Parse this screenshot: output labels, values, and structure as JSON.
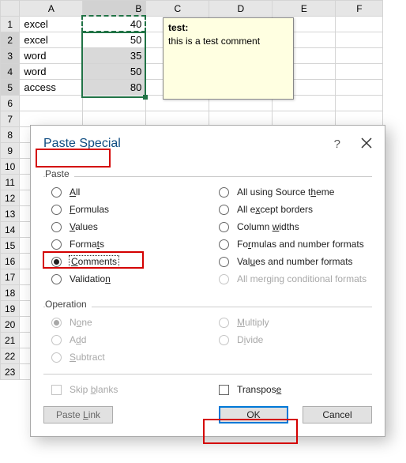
{
  "sheet": {
    "cols": [
      "A",
      "B",
      "C",
      "D",
      "E",
      "F"
    ],
    "rows": [
      {
        "n": "1",
        "a": "excel",
        "b": "40"
      },
      {
        "n": "2",
        "a": "excel",
        "b": "50"
      },
      {
        "n": "3",
        "a": "word",
        "b": "35"
      },
      {
        "n": "4",
        "a": "word",
        "b": "50"
      },
      {
        "n": "5",
        "a": "access",
        "b": "80"
      },
      {
        "n": "6",
        "a": "",
        "b": ""
      },
      {
        "n": "7",
        "a": "",
        "b": ""
      },
      {
        "n": "8",
        "a": "",
        "b": ""
      },
      {
        "n": "9",
        "a": "",
        "b": ""
      },
      {
        "n": "10",
        "a": "",
        "b": ""
      },
      {
        "n": "11",
        "a": "",
        "b": ""
      },
      {
        "n": "12",
        "a": "",
        "b": ""
      },
      {
        "n": "13",
        "a": "",
        "b": ""
      },
      {
        "n": "14",
        "a": "",
        "b": ""
      },
      {
        "n": "15",
        "a": "",
        "b": ""
      },
      {
        "n": "16",
        "a": "",
        "b": ""
      },
      {
        "n": "17",
        "a": "",
        "b": ""
      },
      {
        "n": "18",
        "a": "",
        "b": ""
      },
      {
        "n": "19",
        "a": "",
        "b": ""
      },
      {
        "n": "20",
        "a": "",
        "b": ""
      },
      {
        "n": "21",
        "a": "",
        "b": ""
      },
      {
        "n": "22",
        "a": "",
        "b": ""
      },
      {
        "n": "23",
        "a": "",
        "b": ""
      }
    ]
  },
  "comment": {
    "title": "test:",
    "body": "this is a test comment"
  },
  "dialog": {
    "title": "Paste Special",
    "help": "?",
    "section_paste": "Paste",
    "section_operation": "Operation",
    "paste_opts_left": [
      {
        "label": "All",
        "u": "A"
      },
      {
        "label": "Formulas",
        "u": "F"
      },
      {
        "label": "Values",
        "u": "V"
      },
      {
        "label": "Formats",
        "u": "t"
      },
      {
        "label": "Comments",
        "u": "C"
      },
      {
        "label": "Validation",
        "u": "n"
      }
    ],
    "paste_opts_right": [
      {
        "label": "All using Source theme",
        "u": "h"
      },
      {
        "label": "All except borders",
        "u": "x"
      },
      {
        "label": "Column widths",
        "u": "w"
      },
      {
        "label": "Formulas and number formats",
        "u": "r"
      },
      {
        "label": "Values and number formats",
        "u": "u"
      },
      {
        "label": "All merging conditional formats",
        "u": "g"
      }
    ],
    "op_opts_left": [
      {
        "label": "None",
        "u": "o"
      },
      {
        "label": "Add",
        "u": "d"
      },
      {
        "label": "Subtract",
        "u": "S"
      }
    ],
    "op_opts_right": [
      {
        "label": "Multiply",
        "u": "M"
      },
      {
        "label": "Divide",
        "u": "i"
      }
    ],
    "skip_blanks": "Skip blanks",
    "transpose": "Transpose",
    "paste_link": "Paste Link",
    "ok": "OK",
    "cancel": "Cancel"
  }
}
